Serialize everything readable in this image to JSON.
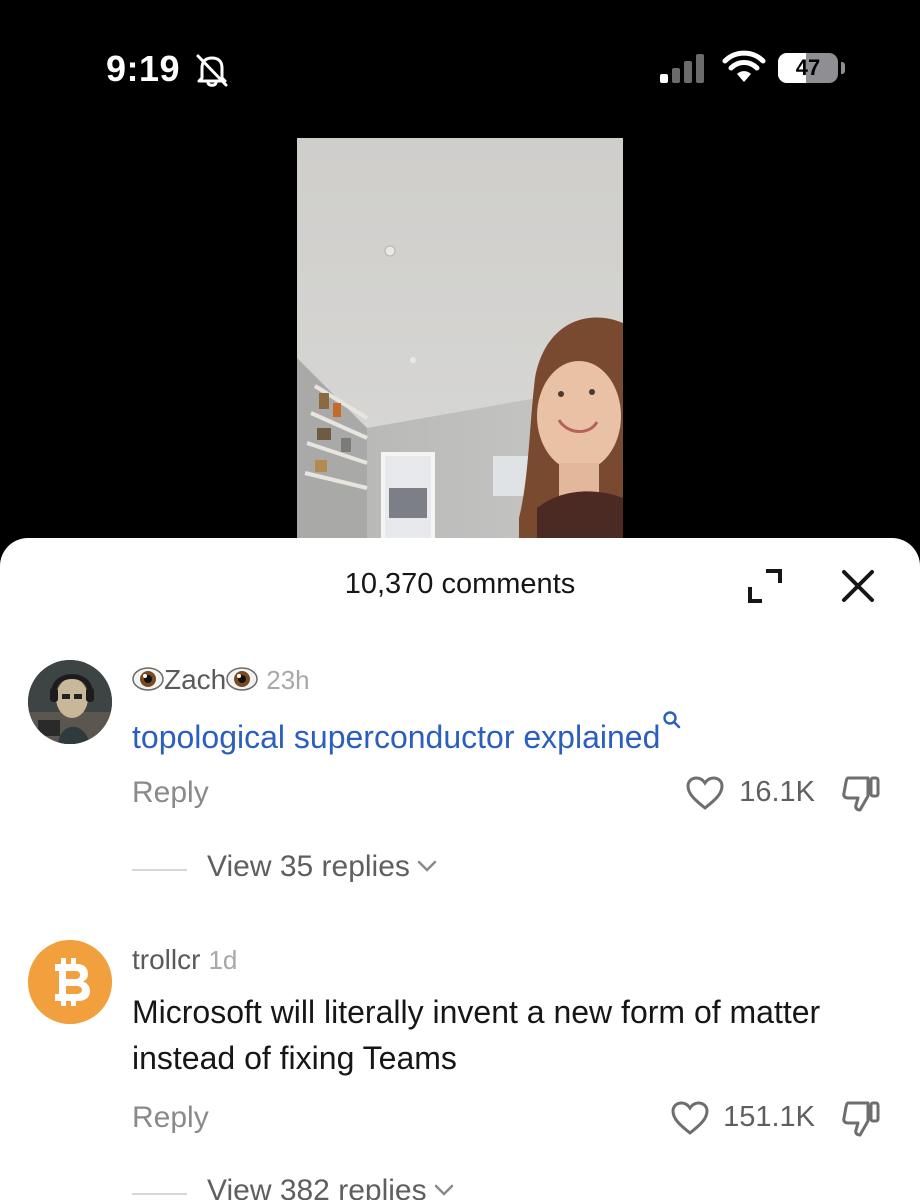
{
  "status_bar": {
    "time": "9:19",
    "battery_level": 47,
    "battery_label": "47",
    "icons": [
      "bell-slash-icon",
      "cellular-signal-icon",
      "wifi-icon",
      "battery-icon"
    ]
  },
  "comments_sheet": {
    "title": "10,370 comments",
    "icons": [
      "expand-icon",
      "close-icon"
    ],
    "comments": [
      {
        "username_prefix_icon": "eyes-emoji",
        "username": "Zach",
        "username_suffix_icon": "eyes-emoji",
        "time": "23h",
        "text": "topological superconductor explained",
        "text_is_search_link": true,
        "reply_label": "Reply",
        "likes": "16.1K",
        "view_replies": "View 35 replies"
      },
      {
        "username": "trollcr",
        "time": "1d",
        "text": "Microsoft will literally invent a new form of matter instead of fixing Teams",
        "avatar_icon": "bitcoin-logo",
        "reply_label": "Reply",
        "likes": "151.1K",
        "view_replies": "View 382 replies"
      }
    ]
  },
  "colors": {
    "link": "#2b5fbf",
    "bitcoin_orange": "#f2a03d",
    "muted_text": "#8a8a8a"
  }
}
